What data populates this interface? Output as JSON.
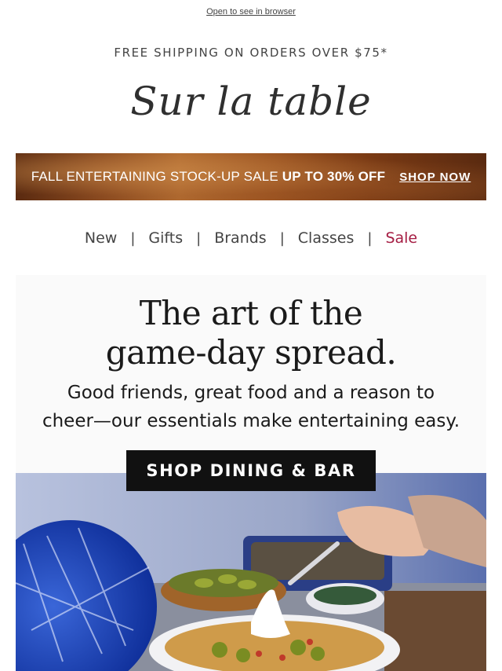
{
  "header": {
    "open_in_browser": "Open to see in browser",
    "shipping_text": "FREE SHIPPING ON ORDERS OVER $75*",
    "logo_text": "Sur la table"
  },
  "banner": {
    "text_regular": "FALL ENTERTAINING STOCK-UP SALE ",
    "text_bold": "UP TO 30% OFF",
    "cta": "SHOP NOW"
  },
  "nav": {
    "items": [
      {
        "label": "New"
      },
      {
        "label": "Gifts"
      },
      {
        "label": "Brands"
      },
      {
        "label": "Classes"
      },
      {
        "label": "Sale"
      }
    ]
  },
  "hero": {
    "headline_line1": "The art of the",
    "headline_line2": "game-day spread.",
    "subhead_line1": "Good friends, great food and a reason to",
    "subhead_line2": "cheer—our essentials make entertaining easy.",
    "cta": "SHOP DINING & BAR"
  },
  "colors": {
    "sale": "#a51d43",
    "button_bg": "#111111",
    "pompom_blue": "#1d46b8"
  }
}
